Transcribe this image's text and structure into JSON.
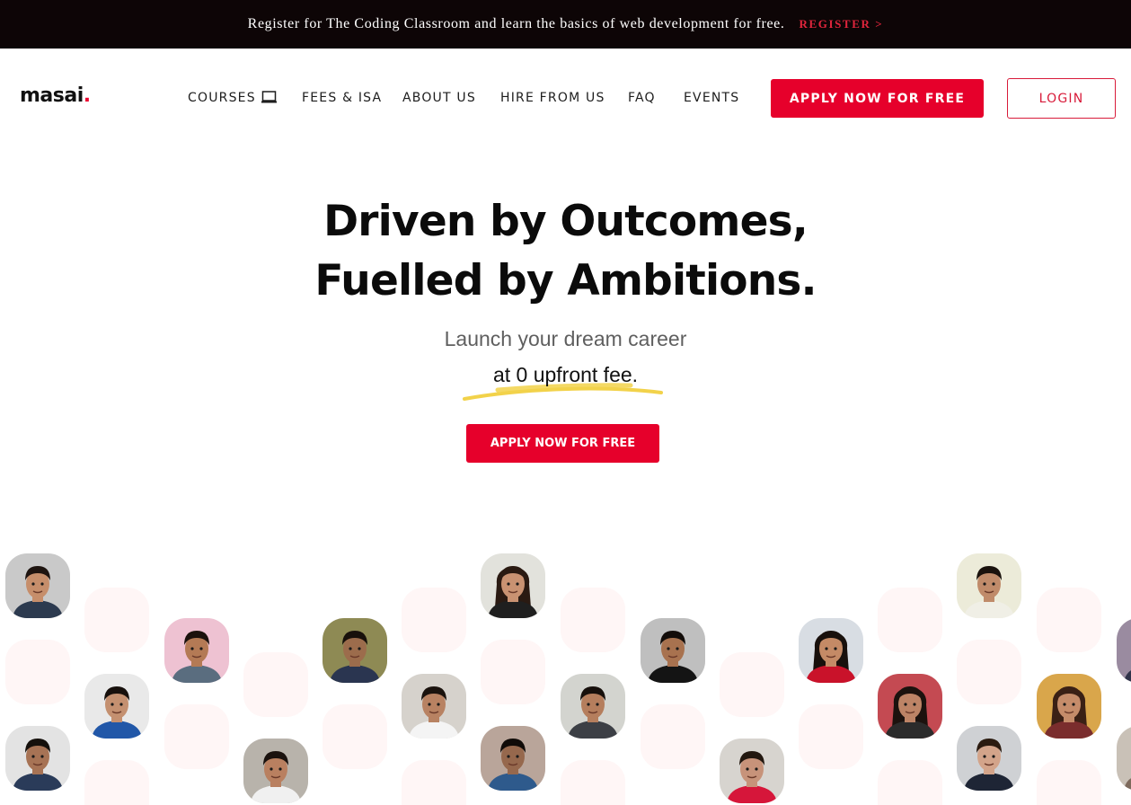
{
  "announcement": {
    "text": "Register for The Coding Classroom and learn the basics of web development for free.",
    "link": "REGISTER >"
  },
  "brand": {
    "name": "masai",
    "dot": "."
  },
  "nav": {
    "items": [
      {
        "label": "COURSES",
        "icon": "laptop-icon"
      },
      {
        "label": "FEES & ISA"
      },
      {
        "label": "ABOUT US"
      },
      {
        "label": "HIRE FROM US"
      },
      {
        "label": "FAQ"
      },
      {
        "label": "EVENTS"
      }
    ],
    "apply_label": "APPLY NOW FOR FREE",
    "login_label": "LOGIN"
  },
  "hero": {
    "title_line1": "Driven by Outcomes,",
    "title_line2": "Fuelled by Ambitions.",
    "subtitle": "Launch your dream career",
    "subtitle2": "at 0 upfront fee.",
    "cta_label": "APPLY NOW FOR FREE"
  },
  "colors": {
    "brand_red": "#e6002b",
    "topbar_bg": "#0d0506",
    "highlight_yellow": "#f2d24a"
  },
  "avatars": [
    {
      "bg": "#c9c9c9",
      "skin": "#c68e6b",
      "hair": "#1e1410",
      "shirt": "#2c3a4f",
      "long_hair": false
    },
    {
      "bg": "#eec2d2",
      "skin": "#b47a55",
      "hair": "#1b120d",
      "shirt": "#5a6d7f",
      "long_hair": false
    },
    {
      "bg": "#8e8a54",
      "skin": "#9c6c4c",
      "hair": "#18100b",
      "shirt": "#2a3550",
      "long_hair": false
    },
    {
      "bg": "#e2e2dc",
      "skin": "#c99272",
      "hair": "#2a1a12",
      "shirt": "#1f1f1f",
      "long_hair": true
    },
    {
      "bg": "#bfbfbf",
      "skin": "#a8724f",
      "hair": "#120c09",
      "shirt": "#141414",
      "long_hair": false
    },
    {
      "bg": "#d8dde3",
      "skin": "#c48a66",
      "hair": "#18100c",
      "shirt": "#c9122a",
      "long_hair": true
    },
    {
      "bg": "#ecebd9",
      "skin": "#c08b6a",
      "hair": "#1a120d",
      "shirt": "#f0efe6",
      "long_hair": false
    },
    {
      "bg": "#e9e9e9",
      "skin": "#c49070",
      "hair": "#17100c",
      "shirt": "#2157a8",
      "long_hair": false
    },
    {
      "bg": "#d6d2cc",
      "skin": "#b88262",
      "hair": "#1b130e",
      "shirt": "#f4f4f4",
      "long_hair": false
    },
    {
      "bg": "#d3d4cf",
      "skin": "#b57e5d",
      "hair": "#17100c",
      "shirt": "#3c3f45",
      "long_hair": false
    },
    {
      "bg": "#c44a52",
      "skin": "#bd8466",
      "hair": "#1c120e",
      "shirt": "#2b2b2b",
      "long_hair": true
    },
    {
      "bg": "#d9a64b",
      "skin": "#c58c6a",
      "hair": "#3a2015",
      "shirt": "#7a2d2d",
      "long_hair": true
    },
    {
      "bg": "#e3e3e3",
      "skin": "#a77355",
      "hair": "#15100c",
      "shirt": "#2a3b59",
      "long_hair": false
    },
    {
      "bg": "#b8b3ab",
      "skin": "#b98060",
      "hair": "#1a120e",
      "shirt": "#f0f0f0",
      "long_hair": false
    },
    {
      "bg": "#b9a59a",
      "skin": "#96684d",
      "hair": "#100b08",
      "shirt": "#2e5a8c",
      "long_hair": false
    },
    {
      "bg": "#d7d4cf",
      "skin": "#c7937a",
      "hair": "#22170f",
      "shirt": "#d6163a",
      "long_hair": false
    },
    {
      "bg": "#cfd1d4",
      "skin": "#d3a48a",
      "hair": "#2b1b10",
      "shirt": "#1e2535",
      "long_hair": false
    },
    {
      "bg": "#9a8ba0",
      "skin": "#b98466",
      "hair": "#16100d",
      "shirt": "#30334a",
      "long_hair": true
    },
    {
      "bg": "#c9c1b7",
      "skin": "#c89674",
      "hair": "#2b1b12",
      "shirt": "#7d6a5c",
      "long_hair": false
    }
  ]
}
